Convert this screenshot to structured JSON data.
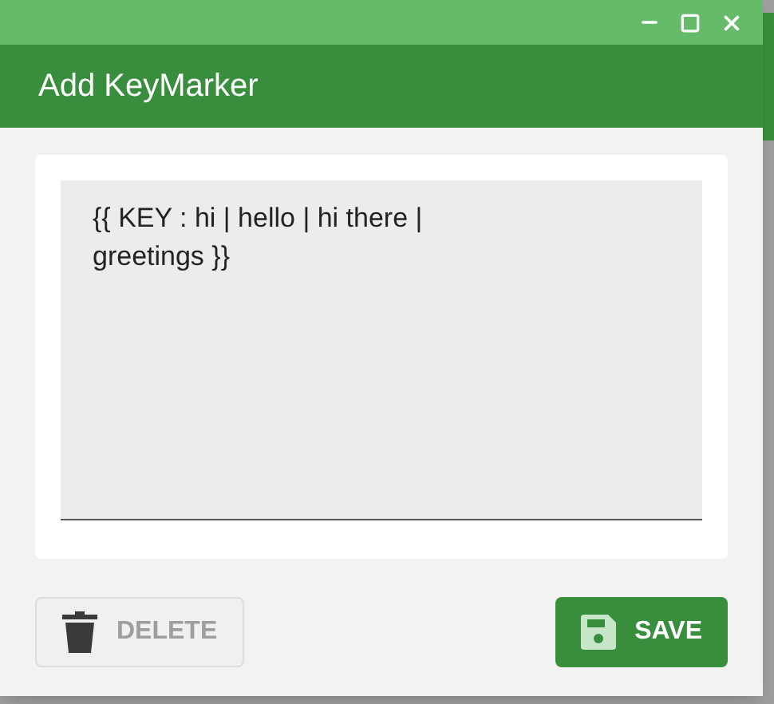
{
  "window": {
    "title": "Add KeyMarker"
  },
  "editor": {
    "value": "{{ KEY : hi | hello | hi there | greetings }}"
  },
  "buttons": [
    {
      "kind": "delete",
      "label": "DELETE",
      "disabled": true
    },
    {
      "kind": "save",
      "label": "SAVE",
      "disabled": false
    }
  ]
}
